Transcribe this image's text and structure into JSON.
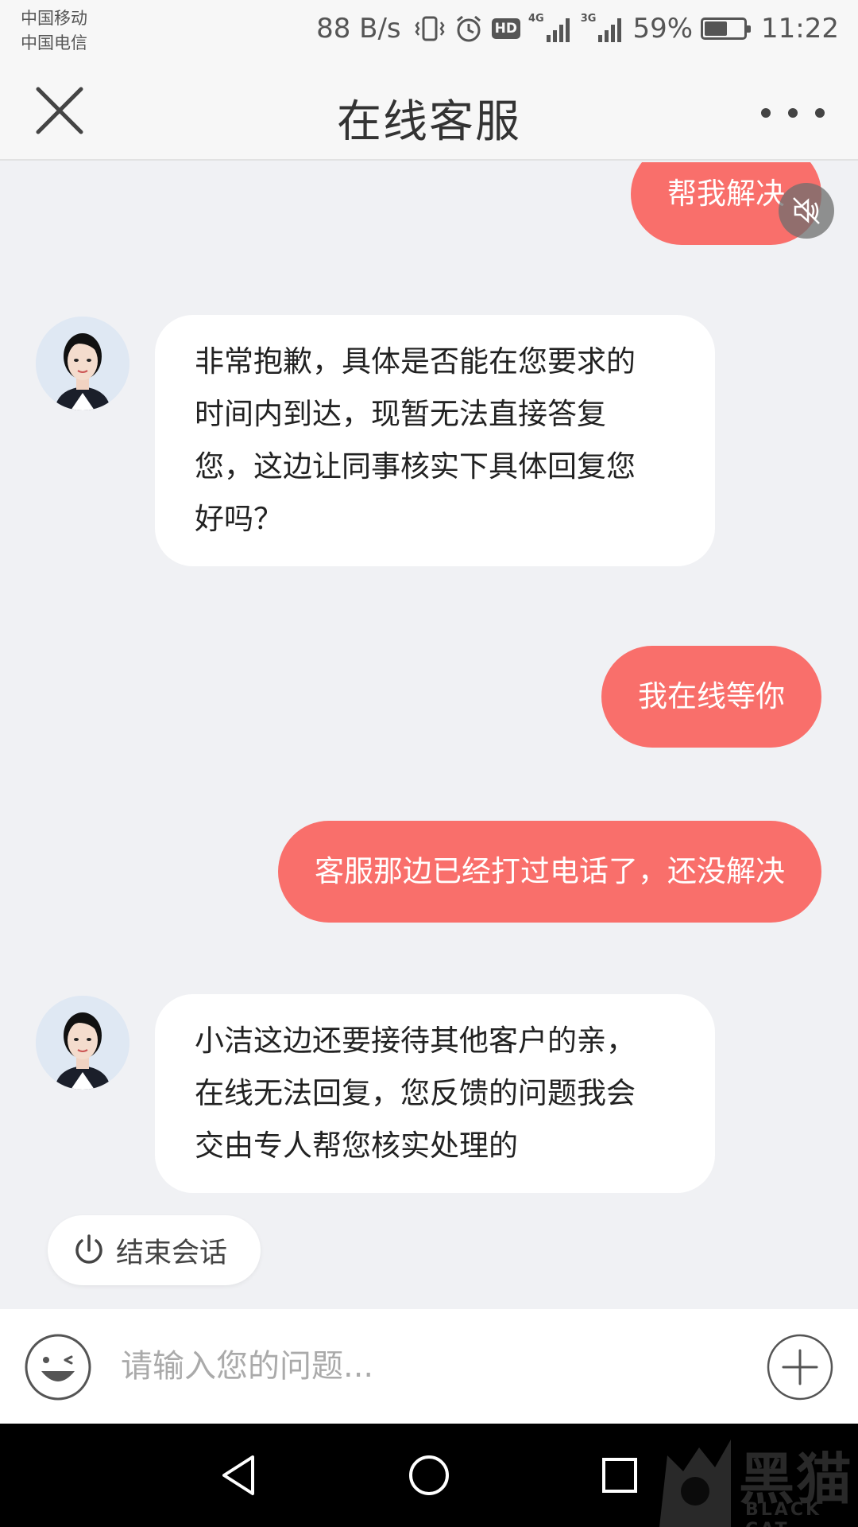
{
  "status_bar": {
    "carrier_1": "中国移动",
    "carrier_2": "中国电信",
    "net_speed": "88 B/s",
    "hd_badge": "HD",
    "net_1": "4G",
    "net_2": "3G",
    "battery_text": "59%",
    "battery_level": 0.59,
    "time": "11:22",
    "icons": [
      "vibrate-icon",
      "alarm-icon",
      "signal-icon",
      "battery-icon"
    ]
  },
  "header": {
    "title": "在线客服",
    "close_icon": "close-icon",
    "more_icon": "more-icon"
  },
  "messages": [
    {
      "sender": "user",
      "text": "帮我解决"
    },
    {
      "sender": "agent",
      "lines": [
        "非常抱歉，具体是否能在您要求的",
        "时间内到达，现暂无法直接答复",
        "您，这边让同事核实下具体回复您",
        "好吗？"
      ]
    },
    {
      "sender": "user",
      "text": "我在线等你"
    },
    {
      "sender": "user",
      "text": "客服那边已经打过电话了，还没解决"
    },
    {
      "sender": "agent",
      "lines": [
        "小洁这边还要接待其他客户的亲，",
        "在线无法回复，您反馈的问题我会",
        "交由专人帮您核实处理的"
      ]
    }
  ],
  "end_session": {
    "label": "结束会话",
    "icon": "power-icon"
  },
  "input": {
    "placeholder": "请输入您的问题...",
    "value": ""
  },
  "nav": {
    "icons": [
      "back-triangle-icon",
      "home-circle-icon",
      "recents-square-icon"
    ]
  },
  "watermark": {
    "text": "黑猫",
    "sub": "BLACK CAT"
  },
  "colors": {
    "user_bubble": "#f96f6b",
    "agent_bubble": "#ffffff",
    "background": "#f0f1f4"
  }
}
